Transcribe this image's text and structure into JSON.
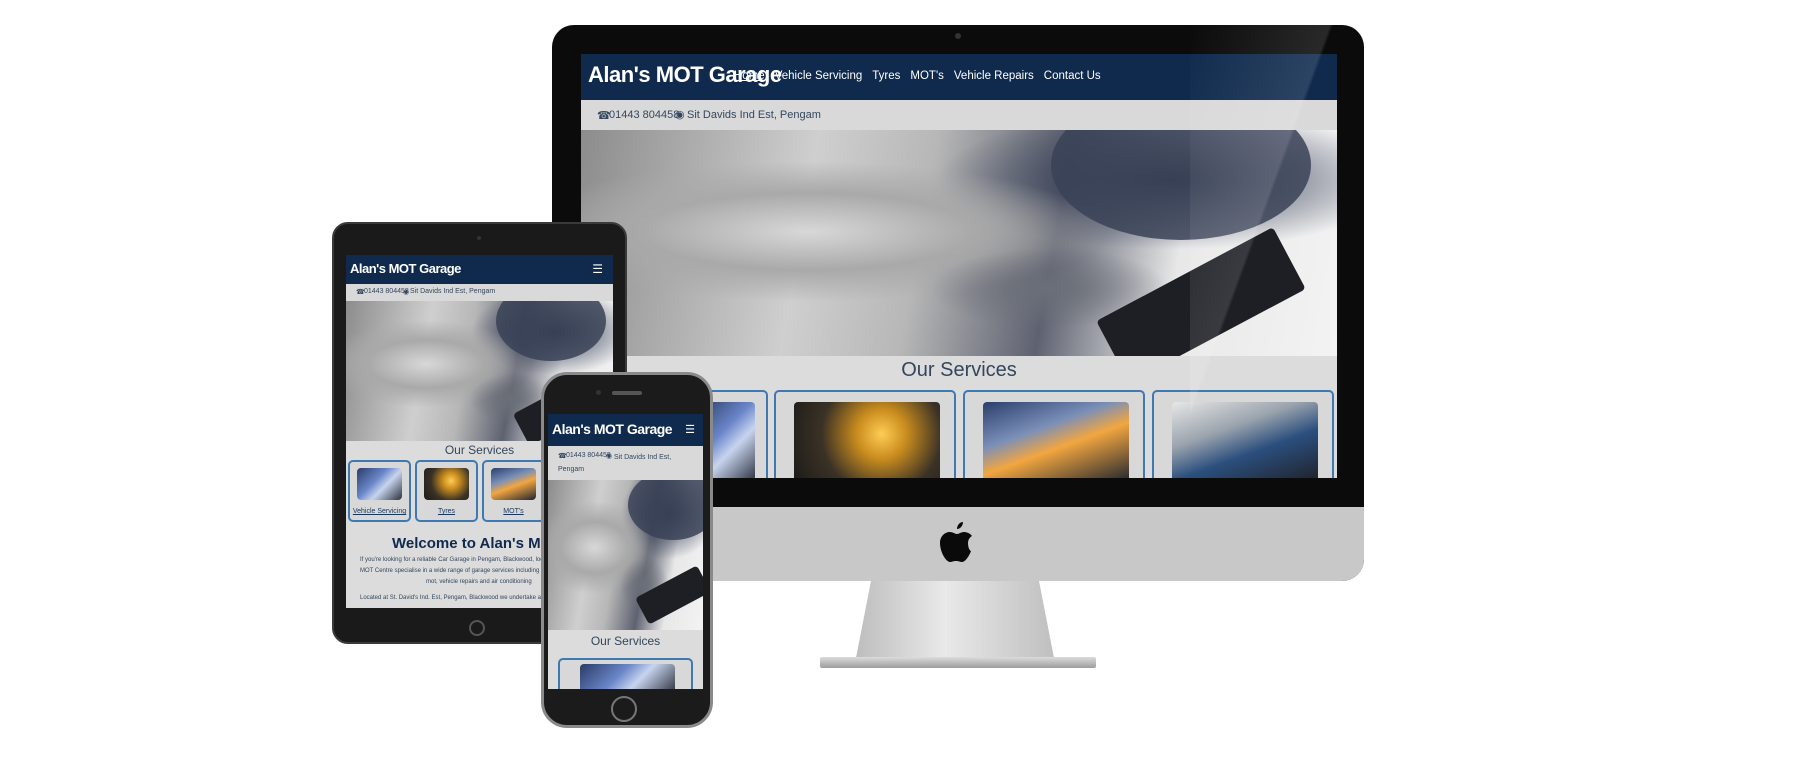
{
  "site": {
    "brand": "Alan's MOT Garage",
    "nav": [
      "Home",
      "Vehicle Servicing",
      "Tyres",
      "MOT's",
      "Vehicle Repairs",
      "Contact Us"
    ],
    "phone": "01443 804458",
    "address": "Sit Davids Ind Est, Pengam",
    "services_title": "Our Services",
    "services": [
      "Vehicle Servicing",
      "Tyres",
      "MOT's"
    ],
    "welcome_title": "Welcome to Alan's MOT Ce",
    "welcome_body_1": "If you're looking for a reliable Car Garage in Pengam, Blackwood, look no",
    "welcome_body_2": "MOT Centre specialise in a wide range of garage services including servicing,",
    "welcome_body_3": "mot, vehicle repairs and air conditioning",
    "welcome_body_4": "Located at St. David's Ind. Est, Pengam, Blackwood we undertake a wide"
  },
  "icons": {
    "phone": "phone-icon",
    "location": "map-marker-icon",
    "menu": "hamburger-menu-icon",
    "apple": "apple-logo-icon"
  },
  "colors": {
    "nav_bg": "#0f2a4d",
    "info_bg": "#d9d9d9",
    "card_border": "#3f79b2",
    "link": "#17375e"
  }
}
